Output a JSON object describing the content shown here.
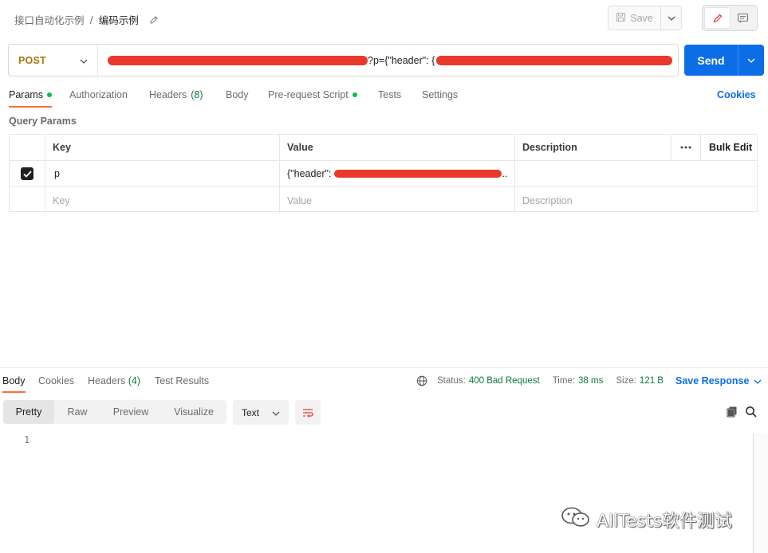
{
  "breadcrumb": {
    "parent": "接口自动化示例",
    "separator": "/",
    "current": "编码示例"
  },
  "toolbar": {
    "save_label": "Save"
  },
  "request": {
    "method": "POST",
    "url_visible_fragment": "?p={\"header\": {",
    "send_label": "Send"
  },
  "request_tabs": [
    {
      "label": "Params",
      "dot": true,
      "active": true
    },
    {
      "label": "Authorization"
    },
    {
      "label": "Headers",
      "count": "(8)"
    },
    {
      "label": "Body"
    },
    {
      "label": "Pre-request Script",
      "dot": true
    },
    {
      "label": "Tests"
    },
    {
      "label": "Settings"
    }
  ],
  "cookies_label": "Cookies",
  "query_params": {
    "section_label": "Query Params",
    "headers": {
      "key": "Key",
      "value": "Value",
      "description": "Description",
      "bulk_edit": "Bulk Edit"
    },
    "rows": [
      {
        "checked": true,
        "key": "p",
        "value_prefix": "{\"header\":",
        "value_suffix": ".."
      }
    ],
    "placeholders": {
      "key": "Key",
      "value": "Value",
      "description": "Description"
    }
  },
  "response": {
    "tabs": [
      {
        "label": "Body",
        "active": true
      },
      {
        "label": "Cookies"
      },
      {
        "label": "Headers",
        "count": "(4)"
      },
      {
        "label": "Test Results"
      }
    ],
    "status_label": "Status:",
    "status_value": "400 Bad Request",
    "time_label": "Time:",
    "time_value": "38 ms",
    "size_label": "Size:",
    "size_value": "121 B",
    "save_response_label": "Save Response",
    "view_modes": [
      "Pretty",
      "Raw",
      "Preview",
      "Visualize"
    ],
    "format": "Text",
    "line_numbers": [
      "1"
    ]
  },
  "watermark": "AllTests软件测试",
  "colors": {
    "accent_orange": "#ff6c37",
    "send_blue": "#0c6ee6",
    "method_post": "#a5760b",
    "status_green": "#0c7b3b",
    "redaction_red": "#e8392c"
  }
}
